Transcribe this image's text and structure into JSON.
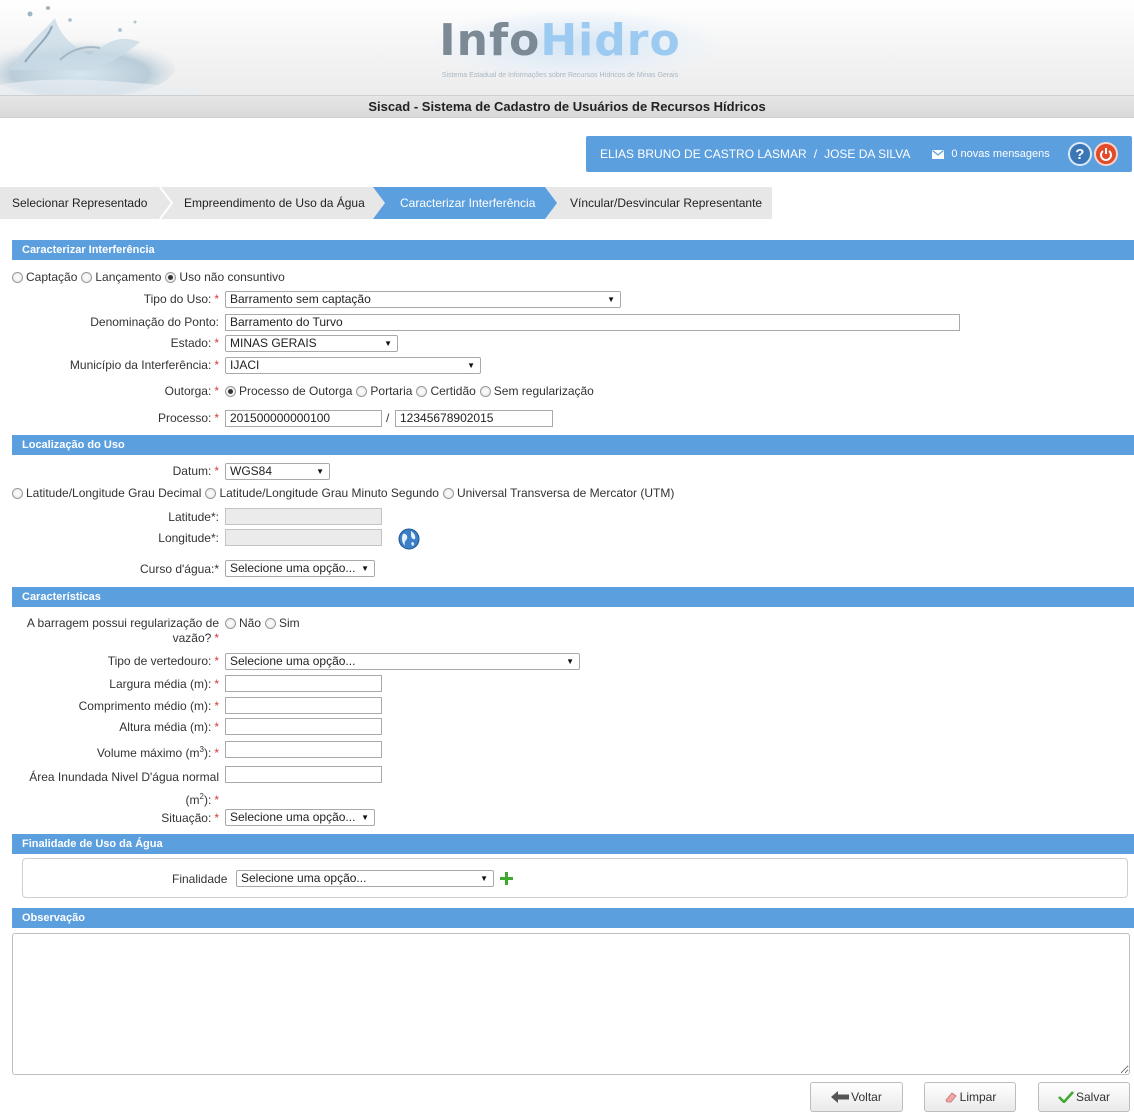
{
  "header": {
    "logo_part1": "Info",
    "logo_part2": "Hidro",
    "logo_subtitle": "Sistema Estadual de Informações sobre Recursos Hídricos de Minas Gerais",
    "system_title": "Siscad - Sistema de Cadastro de Usuários de Recursos Hídricos"
  },
  "user_bar": {
    "user": "ELIAS BRUNO DE CASTRO LASMAR",
    "separator": "/",
    "representative": "JOSE DA SILVA",
    "messages": "0 novas mensagens",
    "help": "?"
  },
  "tabs": [
    {
      "label": "Selecionar Representado",
      "active": false
    },
    {
      "label": "Empreendimento de Uso da Água",
      "active": false
    },
    {
      "label": "Caracterizar Interferência",
      "active": true
    },
    {
      "label": "Víncular/Desvincular Representante",
      "active": false
    }
  ],
  "colors": {
    "accent": "#5c9fde",
    "required": "#d43b3b"
  },
  "interferencia": {
    "section_title": "Caracterizar Interferência",
    "types": [
      "Captação",
      "Lançamento",
      "Uso não consuntivo"
    ],
    "selected_type": "Uso não consuntivo",
    "tipo_uso_label": "Tipo do Uso:",
    "tipo_uso_value": "Barramento sem captação",
    "denominacao_label": "Denominação do Ponto:",
    "denominacao_value": "Barramento do Turvo",
    "estado_label": "Estado:",
    "estado_value": "MINAS GERAIS",
    "municipio_label": "Município da Interferência:",
    "municipio_value": "IJACI",
    "outorga_label": "Outorga:",
    "outorga_options": [
      "Processo de Outorga",
      "Portaria",
      "Certidão",
      "Sem regularização"
    ],
    "outorga_selected": "Processo de Outorga",
    "processo_label": "Processo:",
    "processo_number": "201500000000100",
    "processo_sep": "/",
    "processo_year": "12345678902015"
  },
  "localizacao": {
    "section_title": "Localização do Uso",
    "datum_label": "Datum:",
    "datum_value": "WGS84",
    "coord_options": [
      "Latitude/Longitude Grau Decimal",
      "Latitude/Longitude Grau Minuto Segundo",
      "Universal Transversa de Mercator (UTM)"
    ],
    "latitude_label": "Latitude*:",
    "latitude_value": "",
    "longitude_label": "Longitude*:",
    "longitude_value": "",
    "curso_label": "Curso d'água:*",
    "curso_value": "Selecione uma opção..."
  },
  "caracteristicas": {
    "section_title": "Características",
    "regularizacao_label_1": "A barragem possui regularização de",
    "regularizacao_label_2": "vazão?",
    "regularizacao_options": [
      "Não",
      "Sim"
    ],
    "vertedouro_label": "Tipo de vertedouro:",
    "vertedouro_value": "Selecione uma opção...",
    "largura_label": "Largura média (m):",
    "comprimento_label": "Comprimento médio (m):",
    "altura_label": "Altura média (m):",
    "volume_label": "Volume máximo (m",
    "volume_sup": "3",
    "volume_end": "):",
    "area_label_1": "Área Inundada Nivel D'água normal",
    "area_label_2": "(m",
    "area_sup": "2",
    "area_end": "):",
    "situacao_label": "Situação:",
    "situacao_value": "Selecione uma opção..."
  },
  "finalidade": {
    "section_title": "Finalidade de Uso da Água",
    "label": "Finalidade",
    "value": "Selecione uma opção..."
  },
  "observacao": {
    "section_title": "Observação",
    "value": ""
  },
  "buttons": {
    "voltar": "Voltar",
    "limpar": "Limpar",
    "salvar": "Salvar"
  }
}
